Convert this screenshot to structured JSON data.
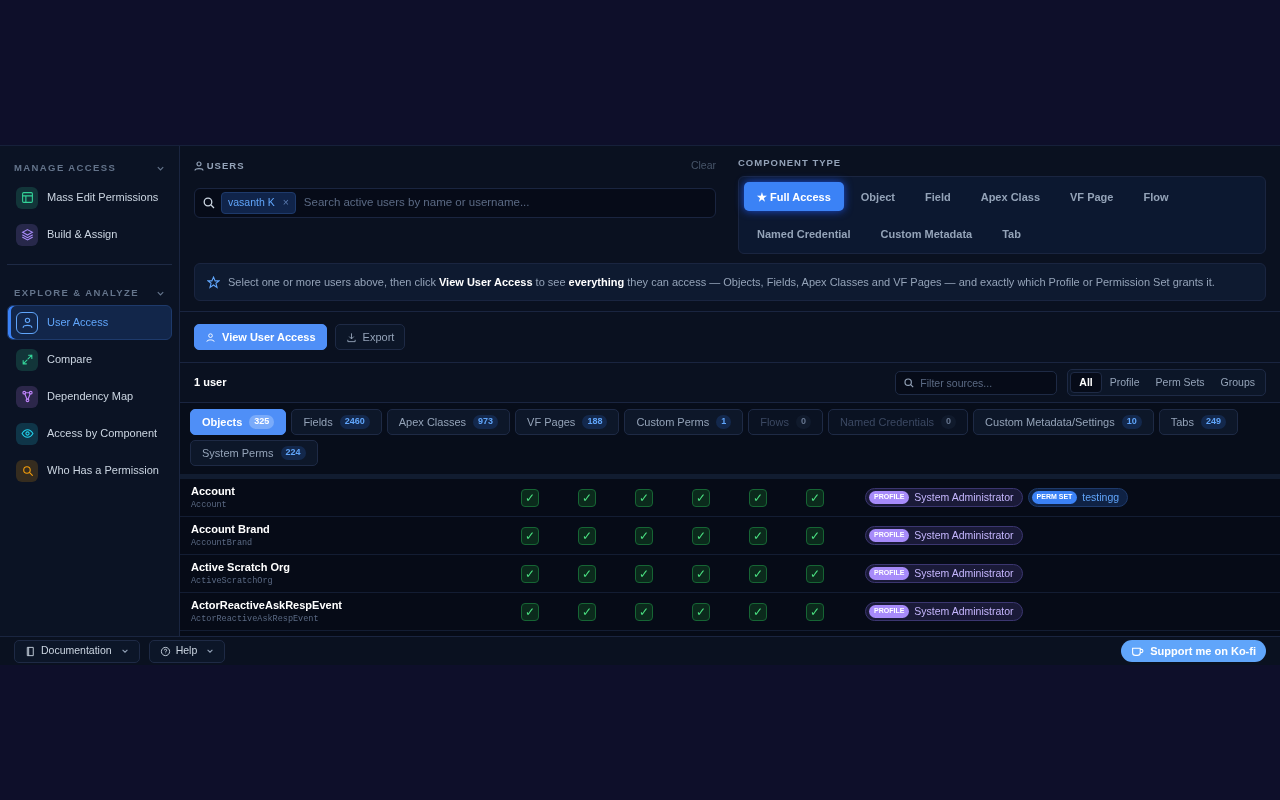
{
  "sidebar": {
    "sections": [
      {
        "title": "MANAGE ACCESS",
        "items": [
          {
            "label": "Mass Edit Permissions",
            "selected": false
          },
          {
            "label": "Build & Assign",
            "selected": false
          }
        ]
      },
      {
        "title": "EXPLORE & ANALYZE",
        "items": [
          {
            "label": "User Access",
            "selected": true
          },
          {
            "label": "Compare",
            "selected": false
          },
          {
            "label": "Dependency Map",
            "selected": false
          },
          {
            "label": "Access by Component",
            "selected": false
          },
          {
            "label": "Who Has a Permission",
            "selected": false
          }
        ]
      }
    ]
  },
  "users": {
    "title": "USERS",
    "clear": "Clear",
    "chips": [
      "vasanth K"
    ],
    "chip_remove": "×",
    "placeholder": "Search active users by name or username..."
  },
  "component_type": {
    "title": "COMPONENT TYPE",
    "options": [
      {
        "label": "★ Full Access",
        "selected": true
      },
      {
        "label": "Object",
        "selected": false
      },
      {
        "label": "Field",
        "selected": false
      },
      {
        "label": "Apex Class",
        "selected": false
      },
      {
        "label": "VF Page",
        "selected": false
      },
      {
        "label": "Flow",
        "selected": false
      },
      {
        "label": "Named Credential",
        "selected": false
      },
      {
        "label": "Custom Metadata",
        "selected": false
      },
      {
        "label": "Tab",
        "selected": false
      }
    ]
  },
  "info": "Select one or more users above, then click **View User Access** to see **everything** they can access — Objects, Fields, Apex Classes and VF Pages — and exactly which Profile or Permission Set grants it.",
  "actions": [
    {
      "label": "View User Access",
      "kind": "primary"
    },
    {
      "label": "Export",
      "kind": "export"
    }
  ],
  "user_count": "1 user",
  "source_filter": {
    "placeholder": "Filter sources...",
    "options": [
      {
        "label": "All",
        "selected": true
      },
      {
        "label": "Profile",
        "selected": false
      },
      {
        "label": "Perm Sets",
        "selected": false
      },
      {
        "label": "Groups",
        "selected": false
      }
    ]
  },
  "categories": [
    {
      "label": "Objects",
      "count": "325",
      "selected": true,
      "disabled": false
    },
    {
      "label": "Fields",
      "count": "2460",
      "selected": false,
      "disabled": false
    },
    {
      "label": "Apex Classes",
      "count": "973",
      "selected": false,
      "disabled": false
    },
    {
      "label": "VF Pages",
      "count": "188",
      "selected": false,
      "disabled": false
    },
    {
      "label": "Custom Perms",
      "count": "1",
      "selected": false,
      "disabled": false
    },
    {
      "label": "Flows",
      "count": "0",
      "selected": false,
      "disabled": true
    },
    {
      "label": "Named Credentials",
      "count": "0",
      "selected": false,
      "disabled": true
    },
    {
      "label": "Custom Metadata/Settings",
      "count": "10",
      "selected": false,
      "disabled": false
    },
    {
      "label": "Tabs",
      "count": "249",
      "selected": false,
      "disabled": false
    },
    {
      "label": "System Perms",
      "count": "224",
      "selected": false,
      "disabled": false
    }
  ],
  "rows": [
    {
      "name": "Account",
      "api": "Account",
      "checks": [
        true,
        true,
        true,
        true,
        true,
        true
      ],
      "sources": [
        {
          "kind": "profile",
          "badge": "PROFILE",
          "name": "System Administrator"
        },
        {
          "kind": "perm_set",
          "badge": "PERM SET",
          "name": "testingg"
        }
      ]
    },
    {
      "name": "Account Brand",
      "api": "AccountBrand",
      "checks": [
        true,
        true,
        true,
        true,
        true,
        true
      ],
      "sources": [
        {
          "kind": "profile",
          "badge": "PROFILE",
          "name": "System Administrator"
        }
      ]
    },
    {
      "name": "Active Scratch Org",
      "api": "ActiveScratchOrg",
      "checks": [
        true,
        true,
        true,
        true,
        true,
        true
      ],
      "sources": [
        {
          "kind": "profile",
          "badge": "PROFILE",
          "name": "System Administrator"
        }
      ]
    },
    {
      "name": "ActorReactiveAskRespEvent",
      "api": "ActorReactiveAskRespEvent",
      "checks": [
        true,
        true,
        true,
        true,
        true,
        true
      ],
      "sources": [
        {
          "kind": "profile",
          "badge": "PROFILE",
          "name": "System Administrator"
        }
      ]
    }
  ],
  "check_mark": "✓",
  "footer": {
    "links": [
      {
        "label": "Documentation"
      },
      {
        "label": "Help"
      }
    ],
    "support": "Support me on Ko-fi"
  }
}
